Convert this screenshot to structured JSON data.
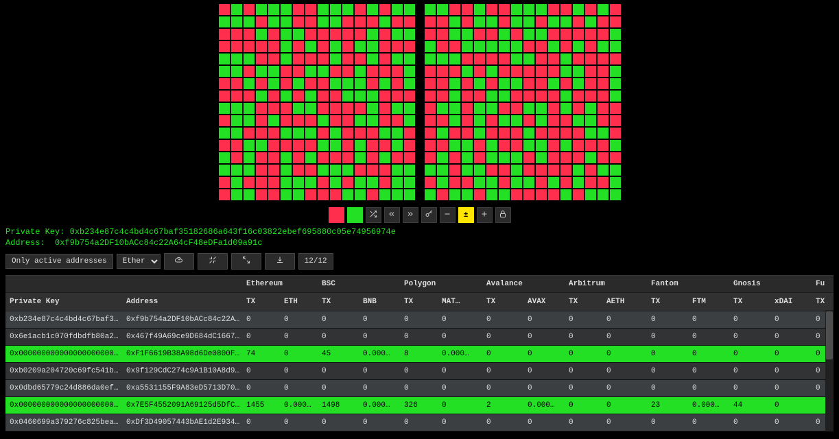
{
  "bitgrid_left": "rgrgggrrgggrgrgg gggrggrrggrrrgrr rrrgrggrrrrrgrgg rrrrrgrgrgrggrrr gggrrgrrrgrrgrgg ggrggrrggrrgrrrg rrgrgrgrrgggrgrg rrrgrgrgrrgggrrr gggrrrggrrrrgrgg rggrgrrrgrrggrrg ggrrrgggrgrrrggr rrggrrrrggrgrrgr grgrrgrgrrrgrgrr gggrrgrrgggrrrgg rgrrrgggrgrggrgg rggrrggrrrggrggg",
  "bitgrid_right": "ggrrgrrgggrrgrgr rrgrggrggrggrgrr rrggrrgrggrrrrrg grrgggggrrgrgrgg gggrrrrggrrgrrrr rrrgrgrrrrrggrrg rrgrgrggrrgrgrrg rrgrrggrrrrgrrrg rggrggrrggrgrgrr rrgrgrggrgrrggrr rgrrgrrrgrrrrggr rrggrgrrggrgrrrg rgrgrgggrgrrrgrr ggrggrrgrrrrgrgg rgrrggrggrgrgrrg grggrggrrrrgrggg",
  "toolbar_icons": [
    "red-icon",
    "green-icon",
    "shuffle-icon",
    "chevrons-left-icon",
    "chevrons-right-icon",
    "key-icon",
    "minus-icon",
    "plus-minus-icon",
    "plus-icon",
    "lock-icon"
  ],
  "private_key_label": "Private Key: ",
  "private_key_value": "0xb234e87c4c4bd4c67baf35182686a643f16c03822ebef695880c05e74956974e",
  "address_label": "Address:",
  "address_value": "0xf9b754a2DF10bACc84c22A64cF48eDFa1d09a91c",
  "controls": {
    "only_active": "Only active addresses",
    "ether_select": "Ether",
    "counter": "12/12"
  },
  "chain_groups": [
    "",
    "",
    "Ethereum",
    "BSC",
    "Polygon",
    "Avalance",
    "Arbitrum",
    "Fantom",
    "Gnosis",
    "Fu"
  ],
  "columns": [
    "Private Key",
    "Address",
    "TX",
    "ETH",
    "TX",
    "BNB",
    "TX",
    "MAT…",
    "TX",
    "AVAX",
    "TX",
    "AETH",
    "TX",
    "FTM",
    "TX",
    "xDAI",
    "TX"
  ],
  "rows": [
    {
      "hl": false,
      "cells": [
        "0xb234e87c4c4bd4c67baf351…",
        "0xf9b754a2DF10bACc84c22A6…",
        "0",
        "0",
        "0",
        "0",
        "0",
        "0",
        "0",
        "0",
        "0",
        "0",
        "0",
        "0",
        "0",
        "0",
        "0"
      ]
    },
    {
      "hl": false,
      "cells": [
        "0x6e1acb1c070fdbdfb80a2a1…",
        "0x467f49A69ce9D684dC1667b…",
        "0",
        "0",
        "0",
        "0",
        "0",
        "0",
        "0",
        "0",
        "0",
        "0",
        "0",
        "0",
        "0",
        "0",
        "0"
      ]
    },
    {
      "hl": true,
      "cells": [
        "0x00000000000000000000000…",
        "0xF1F6619B38A98d6De0800F1…",
        "74",
        "0",
        "45",
        "0.000…",
        "8",
        "0.000…",
        "0",
        "0",
        "0",
        "0",
        "0",
        "0",
        "0",
        "0",
        "0"
      ]
    },
    {
      "hl": false,
      "cells": [
        "0xb0209a204720c69fc541b80…",
        "0x9f129CdC274c9A1B10A8d95…",
        "0",
        "0",
        "0",
        "0",
        "0",
        "0",
        "0",
        "0",
        "0",
        "0",
        "0",
        "0",
        "0",
        "0",
        "0"
      ]
    },
    {
      "hl": false,
      "cells": [
        "0x0dbd65779c24d886da0ef96…",
        "0xa5531155F9A83eD5713D702…",
        "0",
        "0",
        "0",
        "0",
        "0",
        "0",
        "0",
        "0",
        "0",
        "0",
        "0",
        "0",
        "0",
        "0",
        "0"
      ]
    },
    {
      "hl": true,
      "cells": [
        "0x00000000000000000000000…",
        "0x7E5F4552091A69125d5DfCb…",
        "1455",
        "0.000…",
        "1498",
        "0.000…",
        "326",
        "0",
        "2",
        "0.000…",
        "0",
        "0",
        "23",
        "0.000…",
        "44",
        "0"
      ]
    },
    {
      "hl": false,
      "cells": [
        "0x0460699a379276c825beaca…",
        "0xDf3D49057443bAE1d2E934a…",
        "0",
        "0",
        "0",
        "0",
        "0",
        "0",
        "0",
        "0",
        "0",
        "0",
        "0",
        "0",
        "0",
        "0",
        "0"
      ]
    }
  ]
}
